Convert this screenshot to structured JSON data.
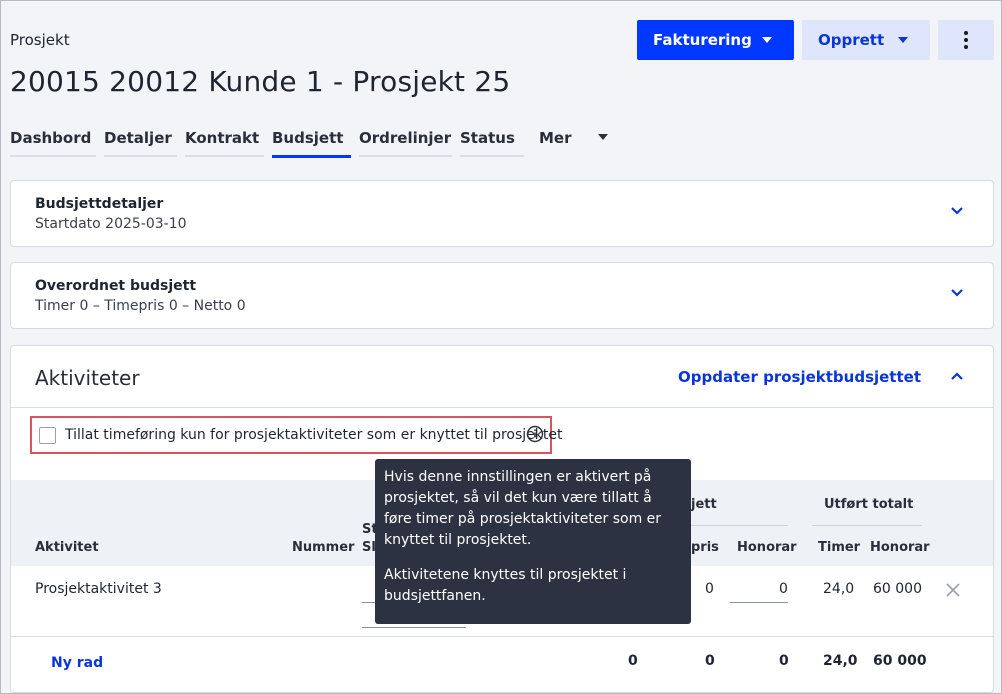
{
  "header": {
    "breadcrumb": "Prosjekt",
    "title": "20015 20012 Kunde 1 - Prosjekt 25",
    "billing_button": "Fakturering",
    "create_button": "Opprett"
  },
  "tabs": [
    "Dashbord",
    "Detaljer",
    "Kontrakt",
    "Budsjett",
    "Ordrelinjer",
    "Status"
  ],
  "tabs_more": "Mer",
  "budget_details": {
    "title": "Budsjettdetaljer",
    "subtitle": "Startdato 2025-03-10"
  },
  "overall_budget": {
    "title": "Overordnet budsjett",
    "subtitle": "Timer 0  –  Timepris 0  –  Netto 0"
  },
  "activities": {
    "title": "Aktiviteter",
    "update_link": "Oppdater prosjektbudsjettet",
    "checkbox_label": "Tillat timeføring kun for prosjektaktiviteter som er knyttet til prosjektet",
    "columns": {
      "activity": "Aktivitet",
      "number": "Nummer",
      "st_partial": "St",
      "sl_partial": "Sl",
      "budget_group_partial": "jett",
      "rate_partial": "pris",
      "fee": "Honorar",
      "done_total": "Utført totalt",
      "hours": "Timer",
      "fee2": "Honorar"
    },
    "row": {
      "name": "Prosjektaktivitet 3",
      "rate_value": "0",
      "fee_value": "0",
      "hours_done": "24,0",
      "fee_done": "60 000"
    },
    "totals": {
      "new_row": "Ny rad",
      "t1": "0",
      "t2": "0",
      "t3": "0",
      "hours": "24,0",
      "fee": "60 000"
    }
  },
  "tooltip": {
    "para1": "Hvis denne innstillingen er aktivert på prosjektet, så vil det kun være tillatt å føre timer på prosjektaktiviteter som er knyttet til prosjektet.",
    "para2": "Aktivitetene knyttes til prosjektet i budsjettfanen."
  },
  "colors": {
    "primary": "#0038ff",
    "secondary_bg": "#dfe5fb",
    "highlight": "#d9555e",
    "tooltip_bg": "#2c3241"
  }
}
